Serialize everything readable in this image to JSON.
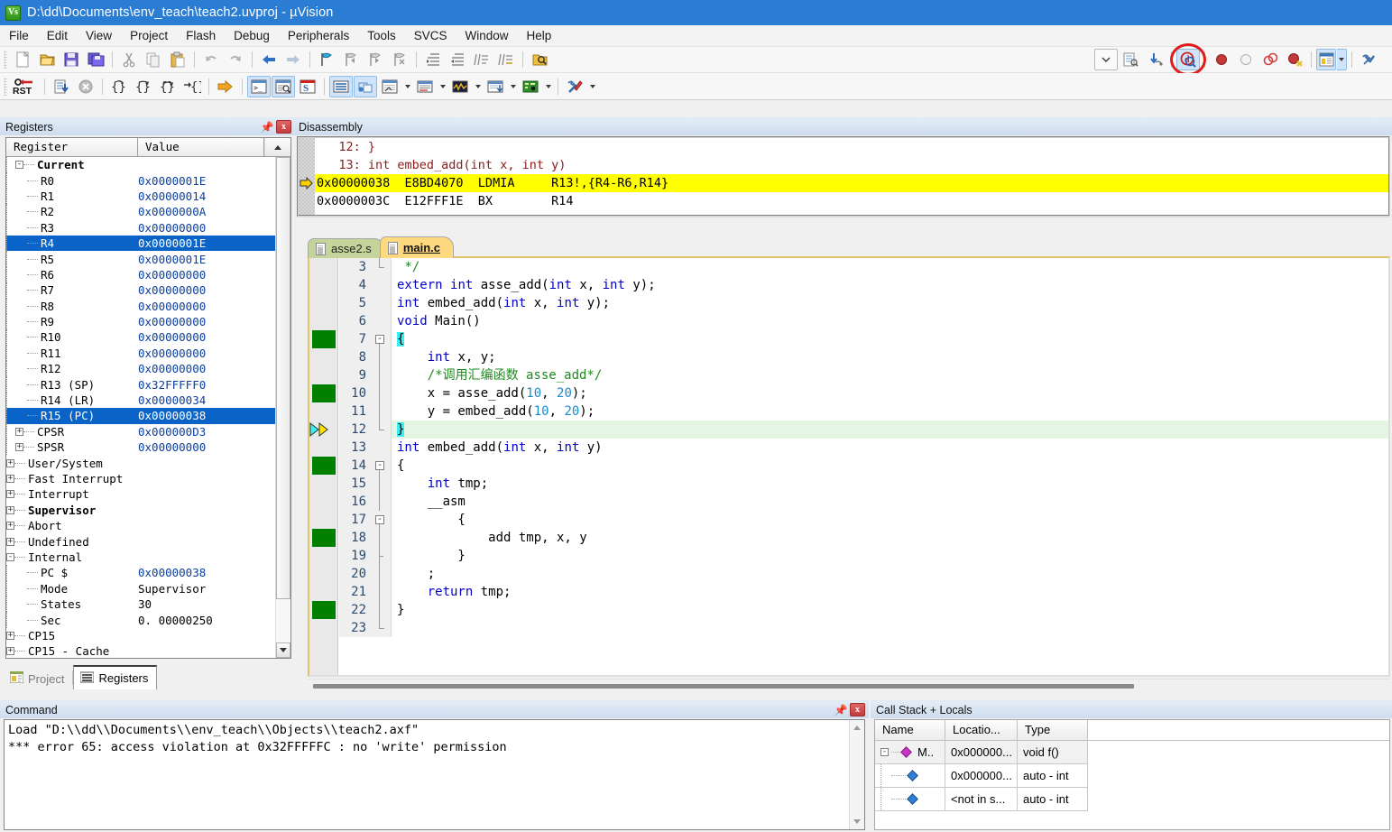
{
  "window": {
    "title": "D:\\dd\\Documents\\env_teach\\teach2.uvproj - µVision",
    "logo_icon": "uvision-logo-icon",
    "logo_text": "Vs"
  },
  "menu": {
    "items": [
      "File",
      "Edit",
      "View",
      "Project",
      "Flash",
      "Debug",
      "Peripherals",
      "Tools",
      "SVCS",
      "Window",
      "Help"
    ]
  },
  "toolbar1": {
    "icons": [
      "new-file-icon",
      "open-file-icon",
      "save-icon",
      "save-all-icon",
      "cut-icon",
      "copy-icon",
      "paste-icon",
      "undo-icon",
      "redo-icon",
      "navigate-back-icon",
      "navigate-forward-icon",
      "bookmark-toggle-icon",
      "bookmark-prev-icon",
      "bookmark-next-icon",
      "bookmark-clear-icon",
      "indent-icon",
      "outdent-icon",
      "comment-icon",
      "uncomment-icon",
      "find-in-files-icon"
    ]
  },
  "toolbar1b": {
    "icons": [
      "dropdown-arrow-icon",
      "insert-file-icon",
      "configure-icon",
      "start-stop-debug-icon",
      "insert-breakpoint-icon",
      "disable-breakpoint-icon",
      "kill-all-breakpoints-icon",
      "disable-all-breakpoints-icon",
      "window-layout-icon",
      "dropdown-arrow-icon",
      "configure-tools-icon"
    ],
    "highlighted_icon": "start-stop-debug-session-icon",
    "annotation": "red-circle-highlight"
  },
  "toolbar2": {
    "icons": [
      "reset-cpu-icon",
      "run-icon",
      "stop-icon",
      "step-icon",
      "step-over-icon",
      "step-out-icon",
      "run-to-cursor-icon",
      "show-next-statement-icon",
      "command-window-icon",
      "disassembly-window-icon",
      "symbols-window-icon",
      "registers-window-icon",
      "call-stack-window-icon",
      "watch-window-icon",
      "memory-window-icon",
      "serial-window-icon",
      "analysis-window-icon",
      "trace-window-icon",
      "system-viewer-icon",
      "toolbox-icon"
    ],
    "reset_label": "RST"
  },
  "registers_panel": {
    "title": "Registers",
    "pin_icon": "pin-icon",
    "close_icon": "close-icon",
    "columns": [
      "Register",
      "Value"
    ],
    "rows": [
      {
        "name": "Current",
        "value": "",
        "indent": 0,
        "toggle": "-",
        "bold": true,
        "selected": false
      },
      {
        "name": "R0",
        "value": "0x0000001E",
        "indent": 1,
        "toggle": "",
        "bold": false,
        "selected": false
      },
      {
        "name": "R1",
        "value": "0x00000014",
        "indent": 1,
        "toggle": "",
        "bold": false,
        "selected": false
      },
      {
        "name": "R2",
        "value": "0x0000000A",
        "indent": 1,
        "toggle": "",
        "bold": false,
        "selected": false
      },
      {
        "name": "R3",
        "value": "0x00000000",
        "indent": 1,
        "toggle": "",
        "bold": false,
        "selected": false
      },
      {
        "name": "R4",
        "value": "0x0000001E",
        "indent": 1,
        "toggle": "",
        "bold": false,
        "selected": true
      },
      {
        "name": "R5",
        "value": "0x0000001E",
        "indent": 1,
        "toggle": "",
        "bold": false,
        "selected": false
      },
      {
        "name": "R6",
        "value": "0x00000000",
        "indent": 1,
        "toggle": "",
        "bold": false,
        "selected": false
      },
      {
        "name": "R7",
        "value": "0x00000000",
        "indent": 1,
        "toggle": "",
        "bold": false,
        "selected": false
      },
      {
        "name": "R8",
        "value": "0x00000000",
        "indent": 1,
        "toggle": "",
        "bold": false,
        "selected": false
      },
      {
        "name": "R9",
        "value": "0x00000000",
        "indent": 1,
        "toggle": "",
        "bold": false,
        "selected": false
      },
      {
        "name": "R10",
        "value": "0x00000000",
        "indent": 1,
        "toggle": "",
        "bold": false,
        "selected": false
      },
      {
        "name": "R11",
        "value": "0x00000000",
        "indent": 1,
        "toggle": "",
        "bold": false,
        "selected": false
      },
      {
        "name": "R12",
        "value": "0x00000000",
        "indent": 1,
        "toggle": "",
        "bold": false,
        "selected": false
      },
      {
        "name": "R13 (SP)",
        "value": "0x32FFFFF0",
        "indent": 1,
        "toggle": "",
        "bold": false,
        "selected": false
      },
      {
        "name": "R14 (LR)",
        "value": "0x00000034",
        "indent": 1,
        "toggle": "",
        "bold": false,
        "selected": false
      },
      {
        "name": "R15 (PC)",
        "value": "0x00000038",
        "indent": 1,
        "toggle": "",
        "bold": false,
        "selected": true
      },
      {
        "name": "CPSR",
        "value": "0x000000D3",
        "indent": 0,
        "toggle": "+",
        "bold": false,
        "selected": false
      },
      {
        "name": "SPSR",
        "value": "0x00000000",
        "indent": 0,
        "toggle": "+",
        "bold": false,
        "selected": false
      },
      {
        "name": "User/System",
        "value": "",
        "indent": -1,
        "toggle": "+",
        "bold": false,
        "selected": false
      },
      {
        "name": "Fast Interrupt",
        "value": "",
        "indent": -1,
        "toggle": "+",
        "bold": false,
        "selected": false
      },
      {
        "name": "Interrupt",
        "value": "",
        "indent": -1,
        "toggle": "+",
        "bold": false,
        "selected": false
      },
      {
        "name": "Supervisor",
        "value": "",
        "indent": -1,
        "toggle": "+",
        "bold": true,
        "selected": false
      },
      {
        "name": "Abort",
        "value": "",
        "indent": -1,
        "toggle": "+",
        "bold": false,
        "selected": false
      },
      {
        "name": "Undefined",
        "value": "",
        "indent": -1,
        "toggle": "+",
        "bold": false,
        "selected": false
      },
      {
        "name": "Internal",
        "value": "",
        "indent": -1,
        "toggle": "-",
        "bold": false,
        "selected": false
      },
      {
        "name": "PC  $",
        "value": "0x00000038",
        "indent": 1,
        "toggle": "",
        "bold": false,
        "selected": false
      },
      {
        "name": "Mode",
        "value": "Supervisor",
        "indent": 1,
        "toggle": "",
        "bold": false,
        "selected": false
      },
      {
        "name": "States",
        "value": "30",
        "indent": 1,
        "toggle": "",
        "bold": false,
        "selected": false
      },
      {
        "name": "Sec",
        "value": "0. 00000250",
        "indent": 1,
        "toggle": "",
        "bold": false,
        "selected": false
      },
      {
        "name": "CP15",
        "value": "",
        "indent": -1,
        "toggle": "+",
        "bold": false,
        "selected": false
      },
      {
        "name": "CP15 - Cache",
        "value": "",
        "indent": -1,
        "toggle": "+",
        "bold": false,
        "selected": false
      }
    ],
    "dock_tabs": [
      {
        "label": "Project",
        "icon": "project-icon",
        "active": false
      },
      {
        "label": "Registers",
        "icon": "registers-icon",
        "active": true
      }
    ]
  },
  "disassembly": {
    "title": "Disassembly",
    "lines": [
      {
        "kind": "source",
        "text": "   12: }",
        "current": false
      },
      {
        "kind": "source",
        "text": "   13: int embed_add(int x, int y)",
        "current": false
      },
      {
        "kind": "asm",
        "text": "0x00000038  E8BD4070  LDMIA     R13!,{R4-R6,R14}",
        "current": true
      },
      {
        "kind": "asm",
        "text": "0x0000003C  E12FFF1E  BX        R14",
        "current": false
      }
    ],
    "pc_marker_icon": "pc-arrow-icon"
  },
  "editor": {
    "tabs": [
      {
        "label": "asse2.s",
        "icon": "file-icon",
        "active": false
      },
      {
        "label": "main.c",
        "icon": "file-icon",
        "active": true
      }
    ],
    "lines": [
      {
        "n": "3",
        "fold": "end",
        "bp": false,
        "cur": false,
        "tokens": [
          {
            "t": " */",
            "c": "cmt"
          }
        ]
      },
      {
        "n": "4",
        "fold": "",
        "bp": false,
        "cur": false,
        "tokens": [
          {
            "t": "extern",
            "c": "kw"
          },
          {
            "t": " ",
            "c": ""
          },
          {
            "t": "int",
            "c": "kw"
          },
          {
            "t": " asse_add(",
            "c": ""
          },
          {
            "t": "int",
            "c": "kw"
          },
          {
            "t": " x, ",
            "c": ""
          },
          {
            "t": "int",
            "c": "kw"
          },
          {
            "t": " y);",
            "c": ""
          }
        ]
      },
      {
        "n": "5",
        "fold": "",
        "bp": false,
        "cur": false,
        "tokens": [
          {
            "t": "int",
            "c": "kw"
          },
          {
            "t": " embed_add(",
            "c": ""
          },
          {
            "t": "int",
            "c": "kw"
          },
          {
            "t": " x, ",
            "c": ""
          },
          {
            "t": "int",
            "c": "kw"
          },
          {
            "t": " y);",
            "c": ""
          }
        ]
      },
      {
        "n": "6",
        "fold": "",
        "bp": false,
        "cur": false,
        "tokens": [
          {
            "t": "void",
            "c": "kw"
          },
          {
            "t": " Main()",
            "c": ""
          }
        ]
      },
      {
        "n": "7",
        "fold": "open",
        "bp": true,
        "cur": false,
        "tokens": [
          {
            "t": "{",
            "c": "hl"
          }
        ]
      },
      {
        "n": "8",
        "fold": "mid",
        "bp": false,
        "cur": false,
        "tokens": [
          {
            "t": "    ",
            "c": ""
          },
          {
            "t": "int",
            "c": "kw"
          },
          {
            "t": " x, y;",
            "c": ""
          }
        ]
      },
      {
        "n": "9",
        "fold": "mid",
        "bp": false,
        "cur": false,
        "tokens": [
          {
            "t": "    /*调用汇编函数 asse_add*/",
            "c": "cmt"
          }
        ]
      },
      {
        "n": "10",
        "fold": "mid",
        "bp": true,
        "cur": false,
        "tokens": [
          {
            "t": "    x = asse_add(",
            "c": ""
          },
          {
            "t": "10",
            "c": "num"
          },
          {
            "t": ", ",
            "c": ""
          },
          {
            "t": "20",
            "c": "num"
          },
          {
            "t": ");",
            "c": ""
          }
        ]
      },
      {
        "n": "11",
        "fold": "mid",
        "bp": false,
        "cur": false,
        "tokens": [
          {
            "t": "    y = embed_add(",
            "c": ""
          },
          {
            "t": "10",
            "c": "num"
          },
          {
            "t": ", ",
            "c": ""
          },
          {
            "t": "20",
            "c": "num"
          },
          {
            "t": ");",
            "c": ""
          }
        ]
      },
      {
        "n": "12",
        "fold": "end",
        "bp": false,
        "cur": true,
        "tokens": [
          {
            "t": "}",
            "c": "hl"
          }
        ],
        "arrows": true
      },
      {
        "n": "13",
        "fold": "",
        "bp": false,
        "cur": false,
        "tokens": [
          {
            "t": "int",
            "c": "kw"
          },
          {
            "t": " embed_add(",
            "c": ""
          },
          {
            "t": "int",
            "c": "kw"
          },
          {
            "t": " x, ",
            "c": ""
          },
          {
            "t": "int",
            "c": "kw"
          },
          {
            "t": " y)",
            "c": ""
          }
        ]
      },
      {
        "n": "14",
        "fold": "open",
        "bp": true,
        "cur": false,
        "tokens": [
          {
            "t": "{",
            "c": ""
          }
        ]
      },
      {
        "n": "15",
        "fold": "mid",
        "bp": false,
        "cur": false,
        "tokens": [
          {
            "t": "    ",
            "c": ""
          },
          {
            "t": "int",
            "c": "kw"
          },
          {
            "t": " tmp;",
            "c": ""
          }
        ]
      },
      {
        "n": "16",
        "fold": "mid",
        "bp": false,
        "cur": false,
        "tokens": [
          {
            "t": "    __asm",
            "c": ""
          }
        ]
      },
      {
        "n": "17",
        "fold": "open",
        "bp": false,
        "cur": false,
        "tokens": [
          {
            "t": "        {",
            "c": ""
          }
        ]
      },
      {
        "n": "18",
        "fold": "mid",
        "bp": true,
        "cur": false,
        "tokens": [
          {
            "t": "            add tmp, x, y",
            "c": ""
          }
        ]
      },
      {
        "n": "19",
        "fold": "endt",
        "bp": false,
        "cur": false,
        "tokens": [
          {
            "t": "        }",
            "c": ""
          }
        ]
      },
      {
        "n": "20",
        "fold": "mid",
        "bp": false,
        "cur": false,
        "tokens": [
          {
            "t": "    ;",
            "c": ""
          }
        ]
      },
      {
        "n": "21",
        "fold": "mid",
        "bp": false,
        "cur": false,
        "tokens": [
          {
            "t": "    ",
            "c": ""
          },
          {
            "t": "return",
            "c": "kw"
          },
          {
            "t": " tmp;",
            "c": ""
          }
        ]
      },
      {
        "n": "22",
        "fold": "mid",
        "bp": true,
        "cur": false,
        "tokens": [
          {
            "t": "}",
            "c": ""
          }
        ]
      },
      {
        "n": "23",
        "fold": "end",
        "bp": false,
        "cur": false,
        "tokens": [
          {
            "t": "",
            "c": ""
          }
        ]
      }
    ]
  },
  "command_panel": {
    "title": "Command",
    "pin_icon": "pin-icon",
    "close_icon": "close-icon",
    "lines": [
      "Load \"D:\\\\dd\\\\Documents\\\\env_teach\\\\Objects\\\\teach2.axf\"",
      "*** error 65: access violation at 0x32FFFFFC : no 'write' permission"
    ]
  },
  "callstack_panel": {
    "title": "Call Stack + Locals",
    "columns": [
      "Name",
      "Locatio...",
      "Type"
    ],
    "rows": [
      {
        "toggle": "-",
        "icon": "function-icon",
        "name": "M..",
        "location": "0x000000...",
        "type": "void f()",
        "level": 0
      },
      {
        "toggle": "",
        "icon": "variable-icon",
        "name": "",
        "location": "0x000000...",
        "type": "auto - int",
        "level": 1
      },
      {
        "toggle": "",
        "icon": "variable-icon",
        "name": "",
        "location": "<not in s...",
        "type": "auto - int",
        "level": 1
      }
    ]
  },
  "colors": {
    "title_bar": "#2b7cd3",
    "selection": "#0a64c8",
    "pc_highlight": "#ffff00",
    "current_line": "#e4f5e4",
    "breakpoint_green": "#008000",
    "annotation_red": "#e01b1b",
    "keyword_blue": "#0000c8",
    "comment_green": "#1e8a1e",
    "number_teal": "#1a8ccc",
    "disasm_source_red": "#8b1a1a"
  }
}
